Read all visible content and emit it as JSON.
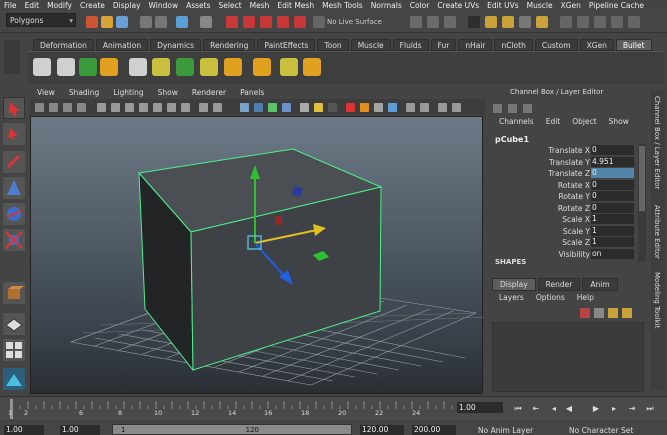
{
  "menu_bar": {
    "items": [
      "File",
      "Edit",
      "Modify",
      "Create",
      "Display",
      "Window",
      "Assets",
      "Select",
      "Mesh",
      "Edit Mesh",
      "Mesh Tools",
      "Normals",
      "Color",
      "Create UVs",
      "Edit UVs",
      "Muscle",
      "XGen",
      "Pipeline Cache"
    ]
  },
  "status_line": {
    "mode": "Polygons",
    "live_surface": "No Live Surface"
  },
  "shelf": {
    "tabs": [
      "Deformation",
      "Animation",
      "Dynamics",
      "Rendering",
      "PaintEffects",
      "Toon",
      "Muscle",
      "Fluids",
      "Fur",
      "nHair",
      "nCloth",
      "Custom",
      "XGen",
      "Bullet"
    ],
    "active_tab": "Bullet"
  },
  "viewport": {
    "menu": [
      "View",
      "Shading",
      "Lighting",
      "Show",
      "Renderer",
      "Panels"
    ]
  },
  "channel_box": {
    "title": "Channel Box / Layer Editor",
    "menu": [
      "Channels",
      "Edit",
      "Object",
      "Show"
    ],
    "object_name": "pCube1",
    "attributes": [
      {
        "label": "Translate X",
        "value": "0"
      },
      {
        "label": "Translate Y",
        "value": "4.951"
      },
      {
        "label": "Translate Z",
        "value": "0"
      },
      {
        "label": "Rotate X",
        "value": "0"
      },
      {
        "label": "Rotate Y",
        "value": "0"
      },
      {
        "label": "Rotate Z",
        "value": "0"
      },
      {
        "label": "Scale X",
        "value": "1"
      },
      {
        "label": "Scale Y",
        "value": "1"
      },
      {
        "label": "Scale Z",
        "value": "1"
      },
      {
        "label": "Visibility",
        "value": "on"
      }
    ],
    "shapes_label": "SHAPES"
  },
  "layer_editor": {
    "tabs": [
      "Display",
      "Render",
      "Anim"
    ],
    "active_tab": "Display",
    "menu": [
      "Layers",
      "Options",
      "Help"
    ]
  },
  "side_tabs": [
    "Channel Box / Layer Editor",
    "Attribute Editor",
    "Modeling Toolkit"
  ],
  "timeline": {
    "ticks": [
      "1",
      "2",
      "6",
      "8",
      "10",
      "12",
      "14",
      "16",
      "18",
      "20",
      "22",
      "24"
    ],
    "current_time": "1.00"
  },
  "range_slider": {
    "start": "1.00",
    "start_inner": "1.00",
    "range_start": "1",
    "range_end": "120",
    "end_inner": "120.00",
    "end": "200.00",
    "anim_layer": "No Anim Layer",
    "character_set": "No Character Set"
  },
  "colors": {
    "accent_selection": "#5285a6",
    "bullet_shelf_active": "#5d5d5d"
  }
}
